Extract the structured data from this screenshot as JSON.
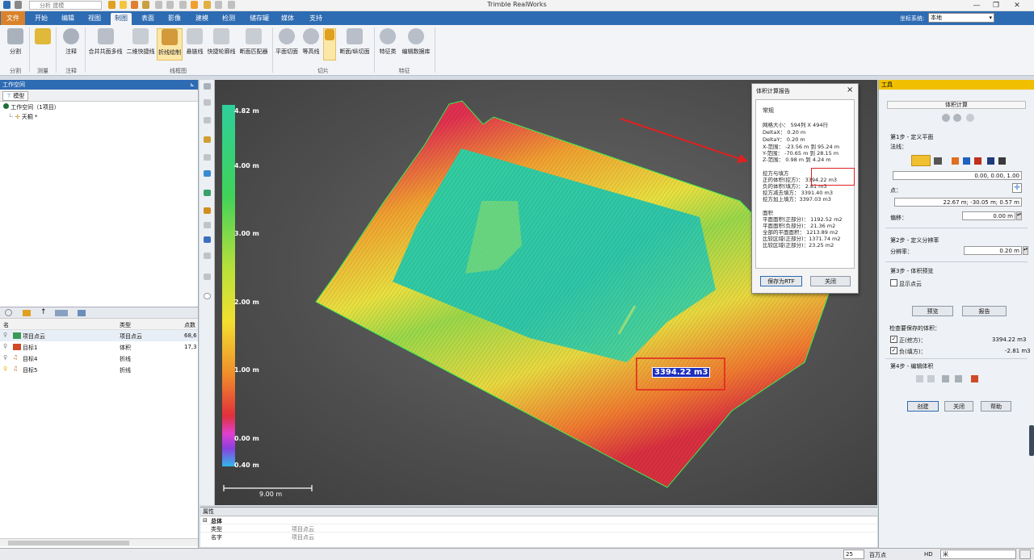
{
  "app": {
    "title": "Trimble RealWorks",
    "search_placeholder": "分析 建模"
  },
  "menu": [
    "文件",
    "开始",
    "编辑",
    "视图",
    "制图",
    "表面",
    "影像",
    "建模",
    "检测",
    "储存罐",
    "媒体",
    "支持"
  ],
  "menu_active_index": 4,
  "coord_system": {
    "label": "坐标系统:",
    "value": "本地"
  },
  "ribbon": {
    "groups": [
      {
        "name": "分割",
        "buttons": [
          "分割"
        ]
      },
      {
        "name": "测量",
        "buttons": [
          ""
        ]
      },
      {
        "name": "注释",
        "buttons": [
          "注释"
        ]
      },
      {
        "name": "线框图",
        "buttons": [
          "合并共面多线",
          "二维快捷线",
          "折线绘制",
          "悬链线",
          "快捷轮廓线",
          "断面匹配器"
        ]
      },
      {
        "name": "切片",
        "buttons": [
          "平面切面",
          "等高线",
          "",
          "断面/纵切面"
        ]
      },
      {
        "name": "特征",
        "buttons": [
          "特征类",
          "编辑数据库"
        ]
      }
    ]
  },
  "workspace": {
    "header": "工作空间",
    "tab": "模型",
    "root": "工作空间（1项目）",
    "project": "天桐",
    "project_suffix": "*",
    "columns": [
      "名",
      "类型",
      "点数"
    ],
    "rows": [
      {
        "name": "项目点云",
        "type": "项目点云",
        "count": "68,6"
      },
      {
        "name": "目标1",
        "type": "体积",
        "count": "17,3"
      },
      {
        "name": "目标4",
        "type": "折线",
        "count": ""
      },
      {
        "name": "目标5",
        "type": "折线",
        "count": ""
      }
    ]
  },
  "properties": {
    "header": "属性",
    "section": "总体",
    "rows": [
      {
        "key": "类型",
        "value": "项目点云"
      },
      {
        "key": "名字",
        "value": "项目点云"
      }
    ]
  },
  "colorbar": {
    "labels": [
      "4.82 m",
      "4.00 m",
      "3.00 m",
      "2.00 m",
      "1.00 m",
      "0.00 m",
      "0.40 m"
    ]
  },
  "scale_bar": "9.00 m",
  "volume_label": "3394.22 m3",
  "report_dialog": {
    "title": "体积计算报告",
    "section_general": "常规",
    "grid_size": "网格大小：  594列 X 494行",
    "delta_x": "DeltaX：  0.20 m",
    "delta_y": "DeltaY：  0.20 m",
    "x_range": "X-范围：  -23.56 m 到  95.24 m",
    "y_range": "Y-范围：  -70.65 m 到  28.15 m",
    "z_range": "Z-范围：  0.98 m 到  4.24 m",
    "section_cutfill": "挖方与填方",
    "positive_volume": "正的体积(挖方)：    3394.22 m3",
    "negative_volume": "负的体积(填方)：    2.81 m3",
    "cut_minus_fill": "挖方减去填方：   3391.40 m3",
    "cut_plus_fill": "挖方加上填方：3397.03 m3",
    "section_area": "面积",
    "plane_area_pos": "平面面积(正部分)：   1192.52 m2",
    "plane_area_neg": "平面面积(负部分)：   21.36 m2",
    "plane_area_total": "全部的平面面积：   1213.89 m2",
    "surface_pos": "比较区域(正部分)：1371.74 m2",
    "surface_neg": "比较区域(正部分)：23.25 m2",
    "save_button": "保存为RTF",
    "close_button": "关闭",
    "close_x": "×"
  },
  "tool_panel": {
    "header": "工具",
    "title": "体积计算",
    "step1": "第1步 - 定义平面",
    "normal_label": "法线：",
    "normal_value": "0.00, 0.00, 1.00",
    "point_label": "点：",
    "point_value": "22.67 m; -30.05 m; 0.57 m",
    "offset_label": "偏移：",
    "offset_value": "0.00 m",
    "step2": "第2步 - 定义分辨率",
    "resolution_label": "分辨率：",
    "resolution_value": "0.20 m",
    "step3": "第3步 - 体积预览",
    "show_points": "显示点云",
    "preview_button": "预览",
    "report_button": "报告",
    "check_label": "检查要保存的体积：",
    "cut_label": "正(挖方)：",
    "cut_value": "3394.22 m3",
    "fill_label": "负(填方)：",
    "fill_value": "-2.81 m3",
    "step4": "第4步 - 编辑体积",
    "create_button": "创建",
    "close_button": "关闭",
    "help_button": "帮助"
  },
  "status": {
    "value": "25",
    "unit": "百万点",
    "mode": "HD",
    "input": "米"
  },
  "colors": {
    "accent": "#2d6bb3",
    "file_tab": "#d9822b",
    "highlight_box": "#e02020",
    "arrow": "#e02020"
  }
}
